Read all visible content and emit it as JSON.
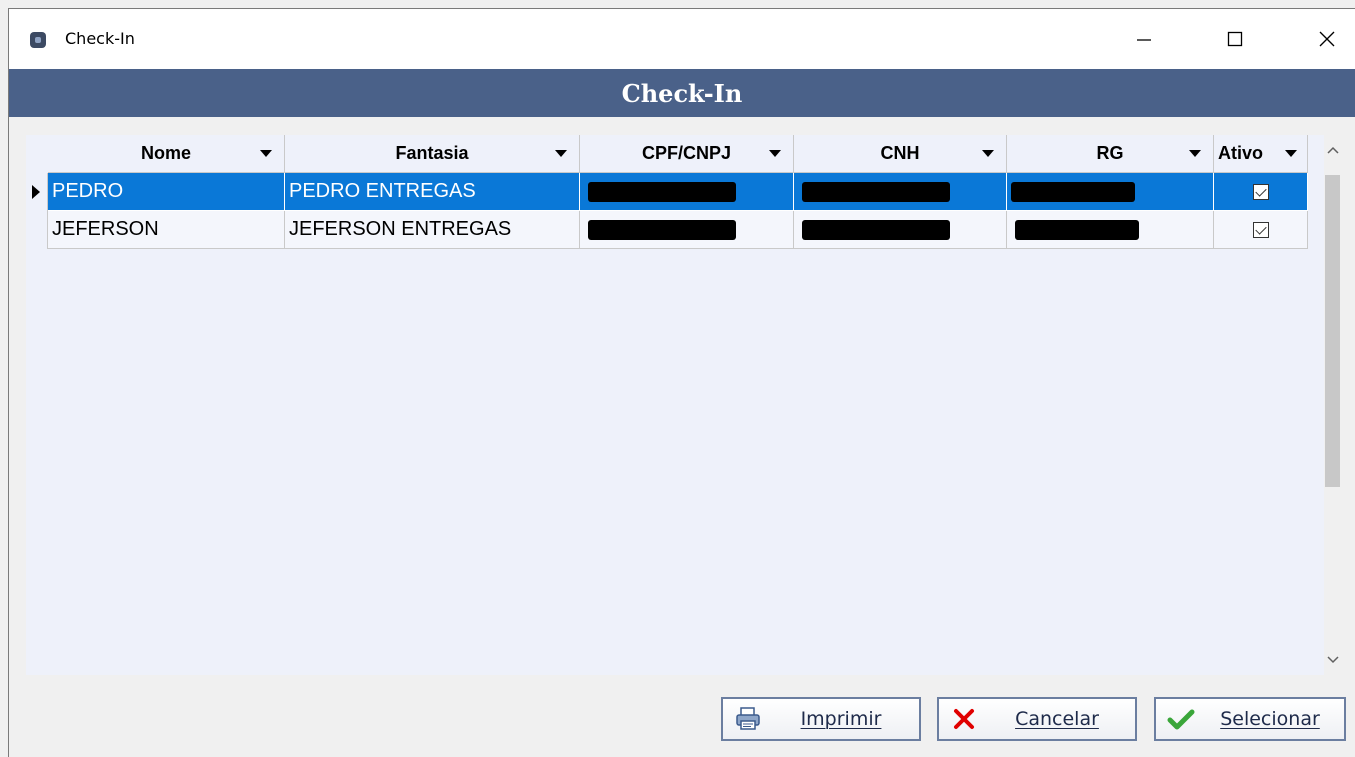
{
  "window": {
    "title": "Check-In"
  },
  "header": {
    "title": "Check-In"
  },
  "grid": {
    "columns": [
      "Nome",
      "Fantasia",
      "CPF/CNPJ",
      "CNH",
      "RG",
      "Ativo"
    ],
    "rows": [
      {
        "nome": "PEDRO",
        "fantasia": "PEDRO ENTREGAS",
        "ativo": true,
        "selected": true
      },
      {
        "nome": "JEFERSON",
        "fantasia": "JEFERSON ENTREGAS",
        "ativo": true,
        "selected": false
      }
    ]
  },
  "buttons": {
    "imprimir": "Imprimir",
    "cancelar": "Cancelar",
    "selecionar": "Selecionar"
  },
  "colors": {
    "header_band": "#4a6189",
    "selection": "#0a78d7"
  },
  "icons": [
    "app-icon",
    "minimize-icon",
    "maximize-icon",
    "close-icon",
    "printer-icon",
    "cancel-x-icon",
    "check-icon",
    "chevron-up-icon",
    "chevron-down-icon"
  ]
}
